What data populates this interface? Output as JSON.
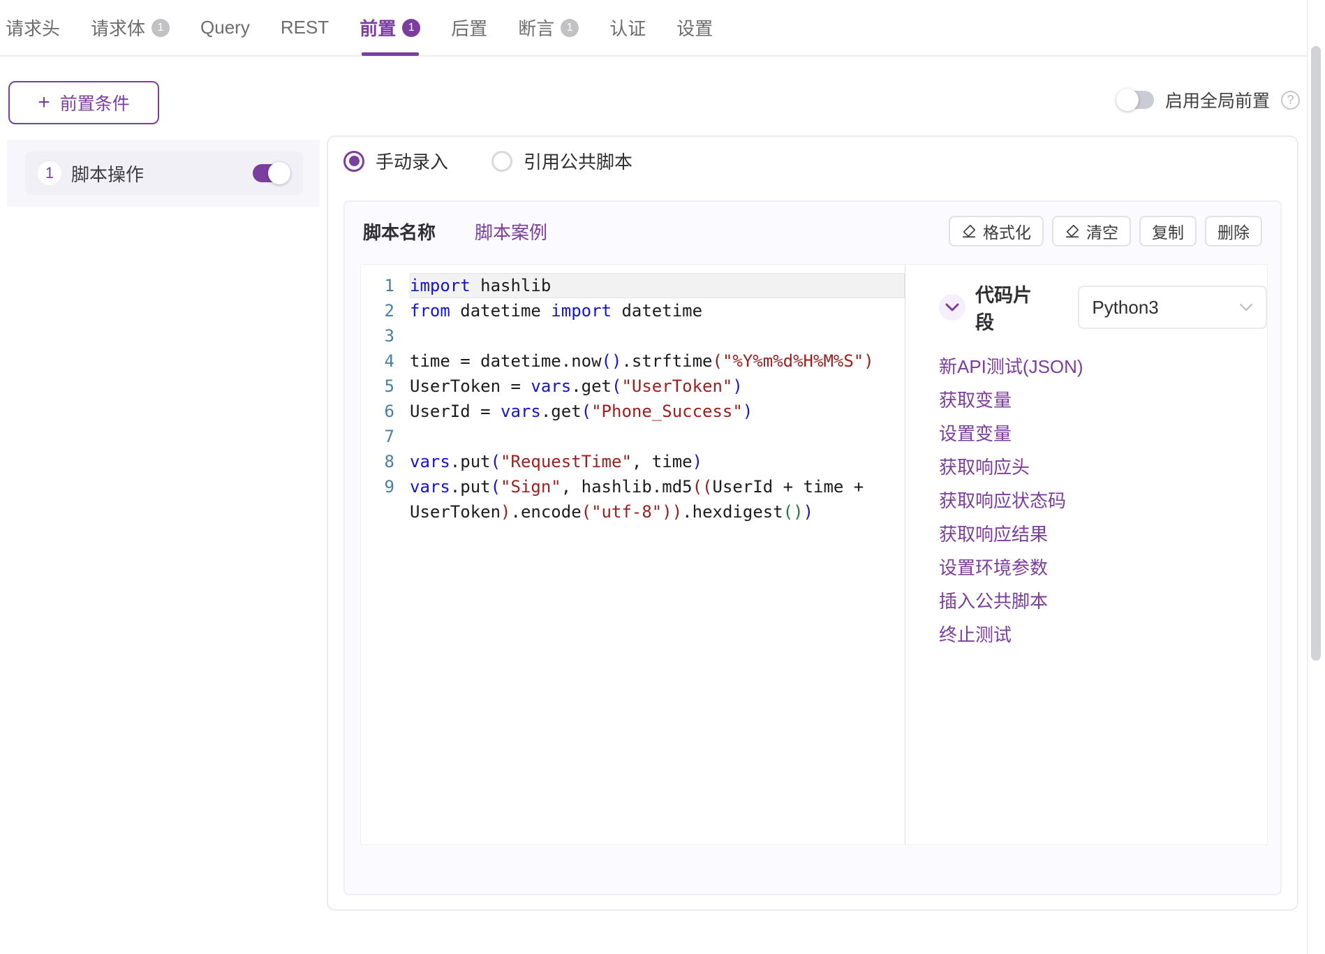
{
  "tabs": [
    {
      "label": "请求头",
      "badge": null,
      "active": false
    },
    {
      "label": "请求体",
      "badge": "1",
      "active": false
    },
    {
      "label": "Query",
      "badge": null,
      "active": false
    },
    {
      "label": "REST",
      "badge": null,
      "active": false
    },
    {
      "label": "前置",
      "badge": "1",
      "active": true
    },
    {
      "label": "后置",
      "badge": null,
      "active": false
    },
    {
      "label": "断言",
      "badge": "1",
      "active": false
    },
    {
      "label": "认证",
      "badge": null,
      "active": false
    },
    {
      "label": "设置",
      "badge": null,
      "active": false
    }
  ],
  "toolbar": {
    "add_label": "前置条件",
    "add_plus": "+",
    "global_toggle_label": "启用全局前置",
    "global_toggle_on": false,
    "help_glyph": "?"
  },
  "steps": [
    {
      "number": "1",
      "label": "脚本操作",
      "enabled": true
    }
  ],
  "source_modes": [
    {
      "label": "手动录入",
      "selected": true
    },
    {
      "label": "引用公共脚本",
      "selected": false
    }
  ],
  "script_panel": {
    "name_label": "脚本名称",
    "case_link": "脚本案例",
    "actions": [
      {
        "label": "格式化",
        "icon": "eraser-icon"
      },
      {
        "label": "清空",
        "icon": "eraser-icon"
      },
      {
        "label": "复制",
        "icon": null
      },
      {
        "label": "删除",
        "icon": null
      }
    ]
  },
  "editor": {
    "active_line": 1,
    "lines": [
      {
        "n": "1",
        "html": "<span class=\"kw\">import</span> hashlib"
      },
      {
        "n": "2",
        "html": "<span class=\"kw\">from</span> datetime <span class=\"kw\">import</span> datetime"
      },
      {
        "n": "3",
        "html": ""
      },
      {
        "n": "4",
        "html": "time = datetime.now<span class=\"p1\">()</span>.strftime<span class=\"p2\">(</span><span class=\"str\">\"%Y%m%d%H%M%S\"</span><span class=\"p2\">)</span>"
      },
      {
        "n": "5",
        "html": "UserToken = <span class=\"kw\">vars</span>.get<span class=\"p1\">(</span><span class=\"str\">\"UserToken\"</span><span class=\"p1\">)</span>"
      },
      {
        "n": "6",
        "html": "UserId = <span class=\"kw\">vars</span>.get<span class=\"p1\">(</span><span class=\"str\">\"Phone_Success\"</span><span class=\"p1\">)</span>"
      },
      {
        "n": "7",
        "html": ""
      },
      {
        "n": "8",
        "html": "<span class=\"kw\">vars</span>.put<span class=\"p1\">(</span><span class=\"str\">\"RequestTime\"</span>, time<span class=\"p1\">)</span>"
      },
      {
        "n": "9",
        "html": "<span class=\"kw\">vars</span>.put<span class=\"p1\">(</span><span class=\"str\">\"Sign\"</span>, hashlib.md5<span class=\"p2\">((</span>UserId + time + UserToken<span class=\"p2\">)</span>.encode<span class=\"p2\">(</span><span class=\"str\">\"utf-8\"</span><span class=\"p2\">))</span>.hexdigest<span class=\"p3\">()</span><span class=\"p1\">)</span>"
      }
    ],
    "plain_text": "import hashlib\nfrom datetime import datetime\n\ntime = datetime.now().strftime(\"%Y%m%d%H%M%S\")\nUserToken = vars.get(\"UserToken\")\nUserId = vars.get(\"Phone_Success\")\n\nvars.put(\"RequestTime\", time)\nvars.put(\"Sign\", hashlib.md5((UserId + time + UserToken).encode(\"utf-8\")).hexdigest())"
  },
  "snippets": {
    "title": "代码片段",
    "language": "Python3",
    "expanded": true,
    "links": [
      "新API测试(JSON)",
      "获取变量",
      "设置变量",
      "获取响应头",
      "获取响应状态码",
      "获取响应结果",
      "设置环境参数",
      "插入公共脚本",
      "终止测试"
    ]
  },
  "colors": {
    "accent": "#7b3e9e",
    "badge_inactive": "#c2c2c4",
    "panel_bg": "#fafaff",
    "text": "#2f2f31",
    "muted": "#6d6d6f",
    "keyword": "#1414cc",
    "string": "#9c1f1f"
  }
}
